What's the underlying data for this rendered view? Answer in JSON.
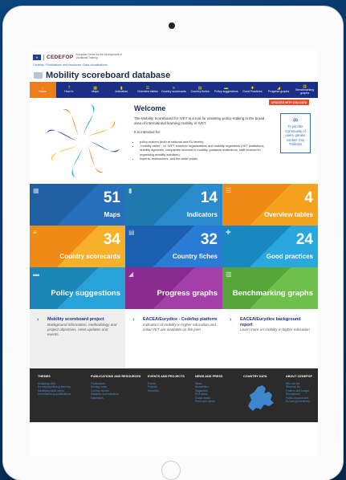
{
  "header": {
    "brand": "CEDEFOP",
    "brand_sub": "European Centre for the Development of Vocational Training",
    "breadcrumb": "Cedefop / Publications and resources / Data visualisations"
  },
  "page_title": "Mobility scoreboard database",
  "nav": [
    {
      "label": "Home",
      "icon": "home-icon",
      "active": true
    },
    {
      "label": "How to",
      "icon": "info-icon",
      "active": false
    },
    {
      "label": "Maps",
      "icon": "map-icon",
      "active": false
    },
    {
      "label": "Indicators",
      "icon": "bars-icon",
      "active": false
    },
    {
      "label": "Overview tables",
      "icon": "table-icon",
      "active": false
    },
    {
      "label": "Country scorecards",
      "icon": "list-icon",
      "active": false
    },
    {
      "label": "Country fiches",
      "icon": "doc-icon",
      "active": false
    },
    {
      "label": "Policy suggestions",
      "icon": "briefcase-icon",
      "active": false
    },
    {
      "label": "Good Practices",
      "icon": "puzzle-icon",
      "active": false
    },
    {
      "label": "Progress graphs",
      "icon": "area-chart-icon",
      "active": false
    },
    {
      "label": "Benchmarking graphs",
      "icon": "bar-chart-icon",
      "active": false
    }
  ],
  "welcome": {
    "title": "Welcome",
    "badge": "UPDATED WITH 2018 DATA",
    "intro": "The Mobility Scoreboard for IVET is a tool for assisting policy-making in the broad area of international learning mobility in IVET.",
    "intended": "It is intended for:",
    "bullets": [
      "policy makers (both at national and EU levels);",
      "\"mobility users\", i.e. IVET learners/ organisations and mobility organisers (VET institutions, mobility agencies, companies involved in mobility, guidance institutions, staff involved in organising mobility activities);",
      "experts, researchers, and the wider public"
    ],
    "join_text": "To join the Community of users, please contact Guy Tchibozo"
  },
  "tiles": [
    {
      "number": "51",
      "label": "Maps",
      "icon": "map-icon",
      "color": "#1f60a3",
      "color2": "#2670bb"
    },
    {
      "number": "14",
      "label": "Indicators",
      "icon": "bars-icon",
      "color": "#1f79b0",
      "color2": "#2a8ccc"
    },
    {
      "number": "4",
      "label": "Overview tables",
      "icon": "table-icon",
      "color": "#ef8a17",
      "color2": "#f5a21f"
    },
    {
      "number": "34",
      "label": "Country scorecards",
      "icon": "list-icon",
      "color": "#ef8a17",
      "color2": "#f6b02a"
    },
    {
      "number": "32",
      "label": "Country fiches",
      "icon": "doc-icon",
      "color": "#1b5fb0",
      "color2": "#2a7bd3"
    },
    {
      "number": "24",
      "label": "Good practices",
      "icon": "puzzle-icon",
      "color": "#1a88c0",
      "color2": "#2aa7dd"
    },
    {
      "number": "",
      "label": "Policy suggestions",
      "icon": "briefcase-icon",
      "color": "#1a86b8",
      "color2": "#28a3d9"
    },
    {
      "number": "",
      "label": "Progress graphs",
      "icon": "area-chart-icon",
      "color": "#8a2b8f",
      "color2": "#a43fa9"
    },
    {
      "number": "",
      "label": "Benchmarking graphs",
      "icon": "bar-chart-icon",
      "color": "#56a53a",
      "color2": "#6fbf4c"
    }
  ],
  "links": [
    {
      "title": "Mobility scoreboard project",
      "desc": "Background information, methodology and project objectives, news updates and events."
    },
    {
      "title": "EACEA/Eurydice - Cedefop platform",
      "desc": "Indicators of mobility in higher education and initial VET are available on the joint ."
    },
    {
      "title": "EACEA/Eurydice background report",
      "desc": "Learn more on mobility in higher education"
    }
  ],
  "footer": [
    {
      "title": "THEMES",
      "items": [
        "Analysing skills",
        "Developing lifelong learning",
        "Identifying skills needs",
        "Understanding qualifications"
      ]
    },
    {
      "title": "PUBLICATIONS AND RESOURCES",
      "items": [
        "Publications",
        "Briefing notes",
        "Country reports",
        "Statistics and indicators",
        "Databases"
      ]
    },
    {
      "title": "EVENTS AND PROJECTS",
      "items": [
        "Events",
        "Projects",
        "Networks"
      ]
    },
    {
      "title": "NEWS AND PRESS",
      "items": [
        "News",
        "Newsletters",
        "Magazines",
        "RSS feeds",
        "Social media",
        "Press and media"
      ]
    },
    {
      "title": "COUNTRY DATA",
      "items": []
    },
    {
      "title": "ABOUT CEDEFOP",
      "items": [
        "Who we are",
        "What we do",
        "Finance and budget",
        "Recruitment",
        "Public procurement",
        "EU law (procedures)"
      ]
    }
  ],
  "colors": {
    "nav_bg": "#1b2f86",
    "nav_active": "#ee7d1b",
    "badge": "#e84a2b",
    "footer_bg": "#2b2b2b"
  }
}
